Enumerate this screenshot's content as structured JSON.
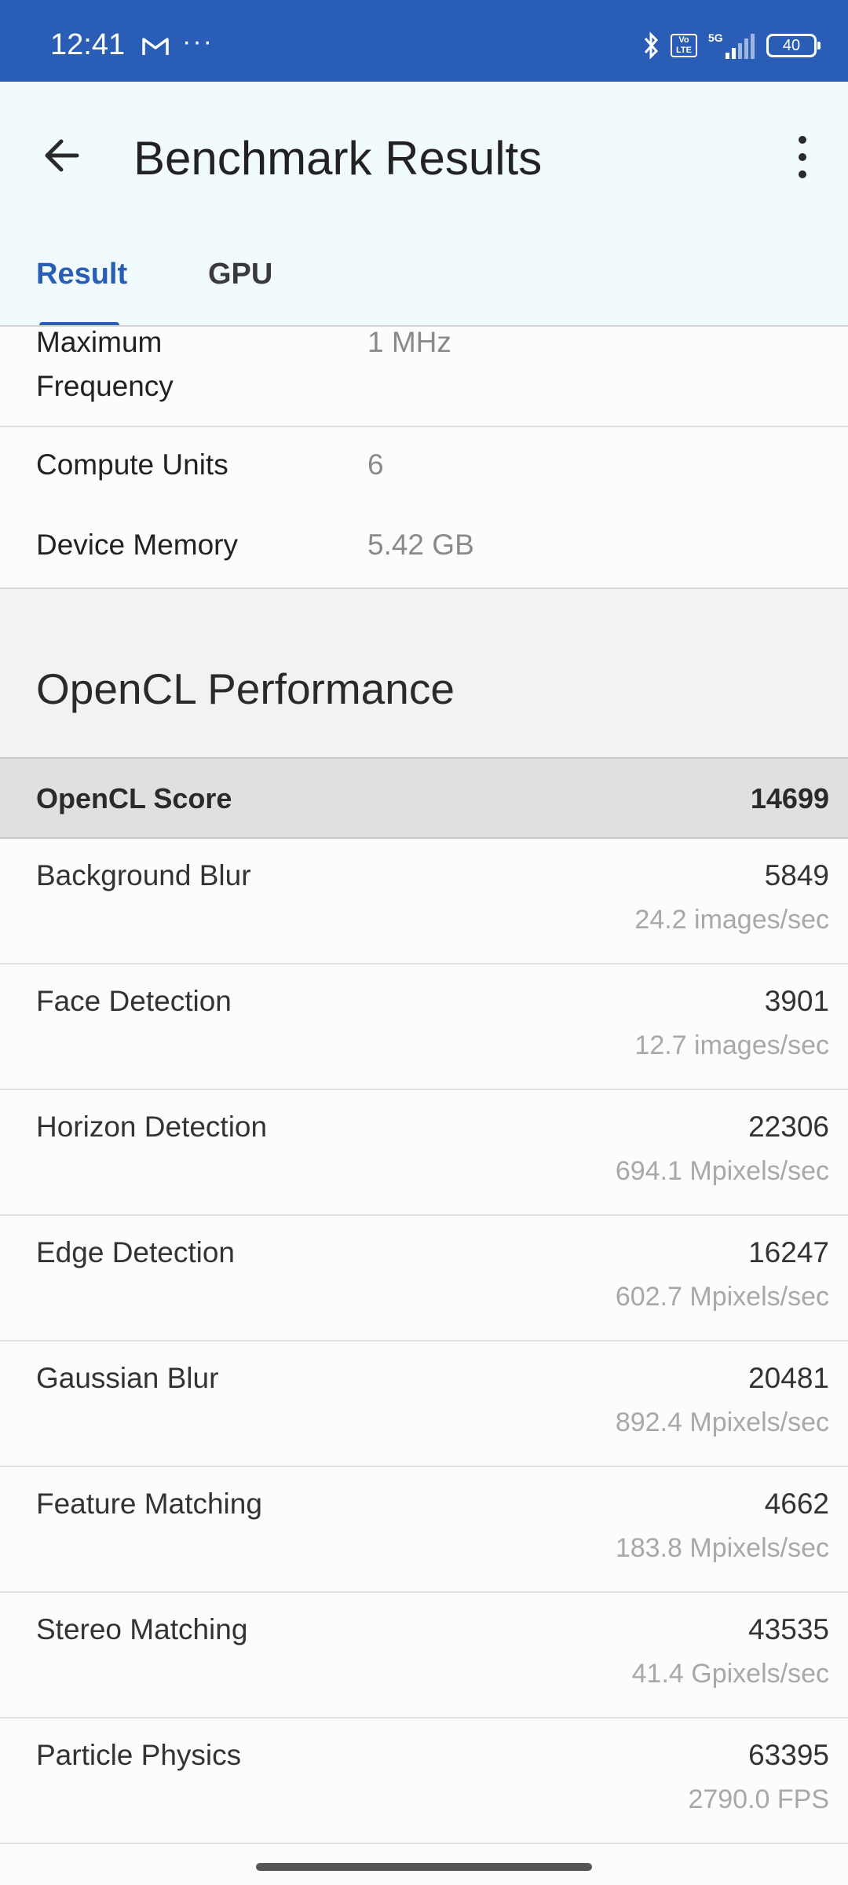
{
  "status_bar": {
    "time": "12:41",
    "dots": "···",
    "network": "5G",
    "volte": "Vo LTE",
    "battery": "40"
  },
  "app_bar": {
    "title": "Benchmark Results",
    "back_icon": "arrow-left-icon",
    "more_icon": "more-vert-icon"
  },
  "tabs": [
    {
      "label": "Result",
      "selected": true
    },
    {
      "label": "GPU",
      "selected": false
    }
  ],
  "device_info": [
    {
      "label": "Maximum Frequency",
      "value": "1 MHz"
    },
    {
      "label": "Compute Units",
      "value": "6"
    },
    {
      "label": "Device Memory",
      "value": "5.42 GB"
    }
  ],
  "section": {
    "title": "OpenCL Performance"
  },
  "score": {
    "label": "OpenCL Score",
    "value": "14699"
  },
  "results": [
    {
      "name": "Background Blur",
      "score": "5849",
      "rate": "24.2 images/sec"
    },
    {
      "name": "Face Detection",
      "score": "3901",
      "rate": "12.7 images/sec"
    },
    {
      "name": "Horizon Detection",
      "score": "22306",
      "rate": "694.1 Mpixels/sec"
    },
    {
      "name": "Edge Detection",
      "score": "16247",
      "rate": "602.7 Mpixels/sec"
    },
    {
      "name": "Gaussian Blur",
      "score": "20481",
      "rate": "892.4 Mpixels/sec"
    },
    {
      "name": "Feature Matching",
      "score": "4662",
      "rate": "183.8 Mpixels/sec"
    },
    {
      "name": "Stereo Matching",
      "score": "43535",
      "rate": "41.4 Gpixels/sec"
    },
    {
      "name": "Particle Physics",
      "score": "63395",
      "rate": "2790.0 FPS"
    }
  ],
  "colors": {
    "status_bar": "#2a5db5",
    "accent": "#2a5db5",
    "app_bar_bg": "#f1fbfe"
  }
}
